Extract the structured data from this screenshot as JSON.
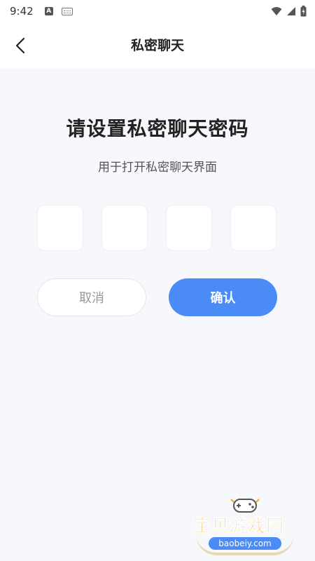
{
  "status_bar": {
    "time": "9:42",
    "icons": [
      "notification-a-icon",
      "keyboard-icon",
      "wifi-icon",
      "signal-icon",
      "battery-icon"
    ]
  },
  "nav": {
    "title": "私密聊天",
    "back_icon": "chevron-left-icon"
  },
  "main": {
    "title": "请设置私密聊天密码",
    "subtitle": "用于打开私密聊天界面",
    "code_length": 4,
    "code_values": [
      "",
      "",
      "",
      ""
    ]
  },
  "buttons": {
    "cancel_label": "取消",
    "confirm_label": "确认"
  },
  "watermark": {
    "text": "宝贝游戏网",
    "url": "baobeiy.com",
    "icon": "gamepad-icon"
  },
  "colors": {
    "background": "#f7f8fc",
    "accent": "#4a8bf6",
    "watermark_orange": "#f5a31a"
  }
}
